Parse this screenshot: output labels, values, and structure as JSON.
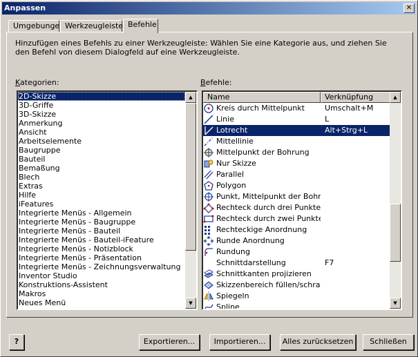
{
  "window": {
    "title": "Anpassen"
  },
  "tabs": [
    {
      "label": "Umgebungen"
    },
    {
      "label": "Werkzeugleisten"
    },
    {
      "label": "Befehle"
    }
  ],
  "description": "Hinzufügen eines Befehls zu einer Werkzeugleiste: Wählen Sie eine Kategorie aus, und ziehen Sie den Befehl von diesem Dialogfeld auf eine Werkzeugleiste.",
  "categories": {
    "label": "Kategorien:",
    "selected": "2D-Skizze",
    "items": [
      "2D-Skizze",
      "3D-Griffe",
      "3D-Skizze",
      "Anmerkung",
      "Ansicht",
      "Arbeitselemente",
      "Baugruppe",
      "Bauteil",
      "Bemaßung",
      "Blech",
      "Extras",
      "Hilfe",
      "iFeatures",
      "Integrierte Menüs - Allgemein",
      "Integrierte Menüs - Baugruppe",
      "Integrierte Menüs - Bauteil",
      "Integrierte Menüs - Bauteil-iFeature",
      "Integrierte Menüs - Notizblock",
      "Integrierte Menüs - Präsentation",
      "Integrierte Menüs - Zeichnungsverwaltung",
      "Inventor Studio",
      "Konstruktions-Assistent",
      "Makros",
      "Neues Menü"
    ]
  },
  "commands": {
    "label": "Befehle:",
    "columns": [
      "Name",
      "Verknüpfung"
    ],
    "selected": "Lotrecht",
    "rows": [
      {
        "name": "Kreis durch Mittelpunkt",
        "shortcut": "Umschalt+M",
        "icon": "circle-center-icon"
      },
      {
        "name": "Linie",
        "shortcut": "L",
        "icon": "line-icon"
      },
      {
        "name": "Lotrecht",
        "shortcut": "Alt+Strg+L",
        "icon": "perpendicular-icon"
      },
      {
        "name": "Mittellinie",
        "shortcut": "",
        "icon": "centerline-icon"
      },
      {
        "name": "Mittelpunkt der Bohrung",
        "shortcut": "",
        "icon": "hole-center-icon"
      },
      {
        "name": "Nur Skizze",
        "shortcut": "",
        "icon": "sketch-only-icon"
      },
      {
        "name": "Parallel",
        "shortcut": "",
        "icon": "parallel-icon"
      },
      {
        "name": "Polygon",
        "shortcut": "",
        "icon": "polygon-icon"
      },
      {
        "name": "Punkt, Mittelpunkt der Bohr...",
        "shortcut": "",
        "icon": "point-icon"
      },
      {
        "name": "Rechteck durch drei Punkte",
        "shortcut": "",
        "icon": "rect-three-points-icon"
      },
      {
        "name": "Rechteck durch zwei Punkte",
        "shortcut": "",
        "icon": "rect-two-points-icon"
      },
      {
        "name": "Rechteckige Anordnung",
        "shortcut": "",
        "icon": "rect-pattern-icon"
      },
      {
        "name": "Runde Anordnung",
        "shortcut": "",
        "icon": "circular-pattern-icon"
      },
      {
        "name": "Rundung",
        "shortcut": "",
        "icon": "fillet-icon"
      },
      {
        "name": "Schnittdarstellung",
        "shortcut": "F7",
        "icon": ""
      },
      {
        "name": "Schnittkanten projizieren",
        "shortcut": "",
        "icon": "project-cut-edges-icon"
      },
      {
        "name": "Skizzenbereich füllen/schraf...",
        "shortcut": "",
        "icon": "fill-hatch-icon"
      },
      {
        "name": "Spiegeln",
        "shortcut": "",
        "icon": "mirror-icon"
      },
      {
        "name": "Spline",
        "shortcut": "",
        "icon": "spline-icon"
      }
    ]
  },
  "buttons": {
    "help": "?",
    "export": "Exportieren...",
    "import": "Importieren...",
    "reset_all": "Alles zurücksetzen",
    "close": "Schließen"
  }
}
